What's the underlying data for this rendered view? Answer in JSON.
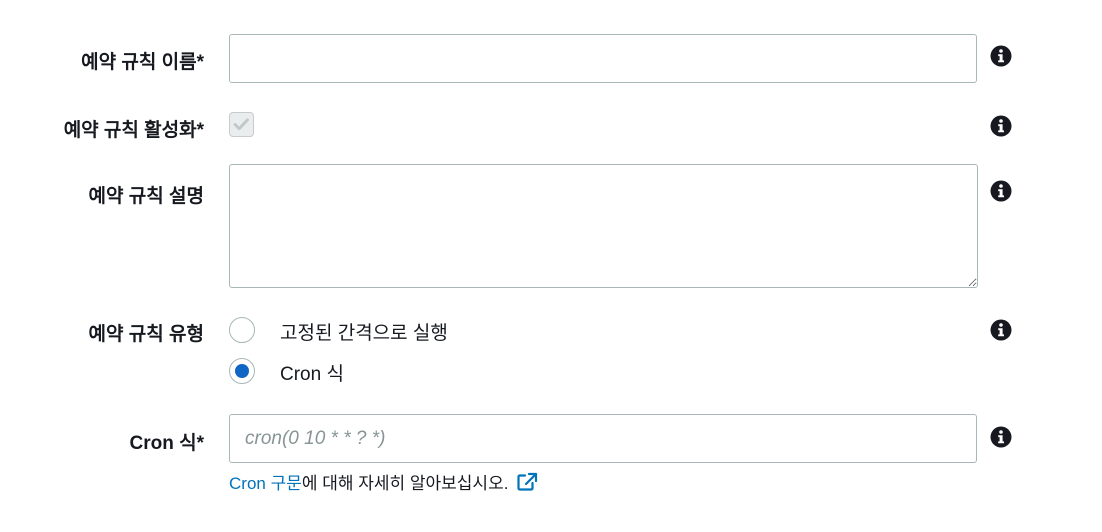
{
  "fields": {
    "name": {
      "label": "예약 규칙 이름*",
      "value": "",
      "placeholder": ""
    },
    "enabled": {
      "label": "예약 규칙 활성화*",
      "checked": true,
      "disabled": true
    },
    "description": {
      "label": "예약 규칙 설명",
      "value": ""
    },
    "type": {
      "label": "예약 규칙 유형",
      "options": [
        {
          "label": "고정된 간격으로 실행",
          "selected": false
        },
        {
          "label": "Cron 식",
          "selected": true
        }
      ]
    },
    "cron": {
      "label": "Cron 식*",
      "value": "",
      "placeholder": "cron(0 10 * * ? *)",
      "help_link": "Cron 구문",
      "help_suffix": "에 대해 자세히 알아보십시오."
    }
  },
  "icons": {
    "info": "info-circle-icon",
    "external": "external-link-icon",
    "check": "checkmark-icon"
  },
  "colors": {
    "link": "#0073bb",
    "radio_selected": "#1066c4",
    "border": "#aab7b8",
    "icon": "#16191f"
  }
}
